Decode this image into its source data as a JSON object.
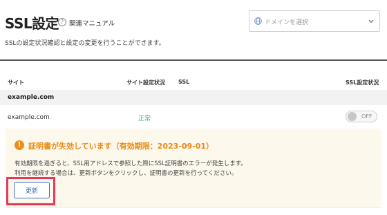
{
  "header": {
    "title": "SSL設定",
    "manual_link": "関連マニュアル",
    "help_icon": "?"
  },
  "domain_select": {
    "placeholder": "ドメインを選択",
    "icon": "globe-icon"
  },
  "description": "SSLの設定状況確認と設定の変更を行うことができます。",
  "table": {
    "columns": [
      "サイト",
      "サイト設定状況",
      "SSL",
      "SSL設定状況"
    ],
    "group_label": "example.com",
    "row": {
      "domain": "example.com",
      "site_status": "正常",
      "ssl_toggle": "OFF"
    }
  },
  "warning": {
    "icon_text": "!",
    "title": "証明書が失効しています（有効期限：2023-09-01）",
    "line1": "有効期限を過ぎると、SSL用アドレスで参照した際にSSL証明書のエラーが発生します。",
    "line2": "利用を継続する場合は、更新ボタンをクリックし、証明書の更新を行ってください。",
    "button_label": "更新"
  },
  "colors": {
    "status_ok": "#3aaa9a",
    "warning": "#ea8a12",
    "warning_bg": "#fdf8ec",
    "highlight": "#e8375a",
    "button": "#3b6fb6"
  }
}
